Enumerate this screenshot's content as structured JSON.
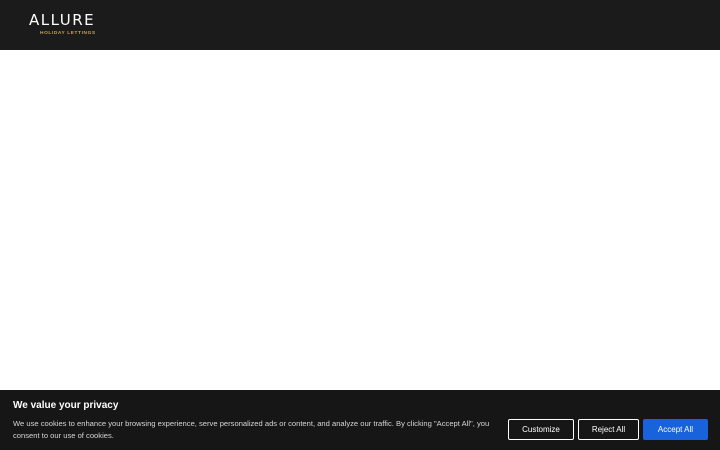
{
  "header": {
    "logo_main": "ALLURE",
    "logo_sub": "HOLIDAY LETTINGS"
  },
  "cookie_banner": {
    "title": "We value your privacy",
    "text": "We use cookies to enhance your browsing experience, serve personalized ads or content, and analyze our traffic. By clicking \"Accept All\", you consent to our use of cookies.",
    "buttons": {
      "customize": "Customize",
      "reject": "Reject All",
      "accept": "Accept All"
    },
    "colors": {
      "background": "#161616",
      "accept": "#1863dc"
    }
  },
  "colors": {
    "header_bg": "#1b1b1b",
    "logo_accent": "#c9a25a"
  }
}
